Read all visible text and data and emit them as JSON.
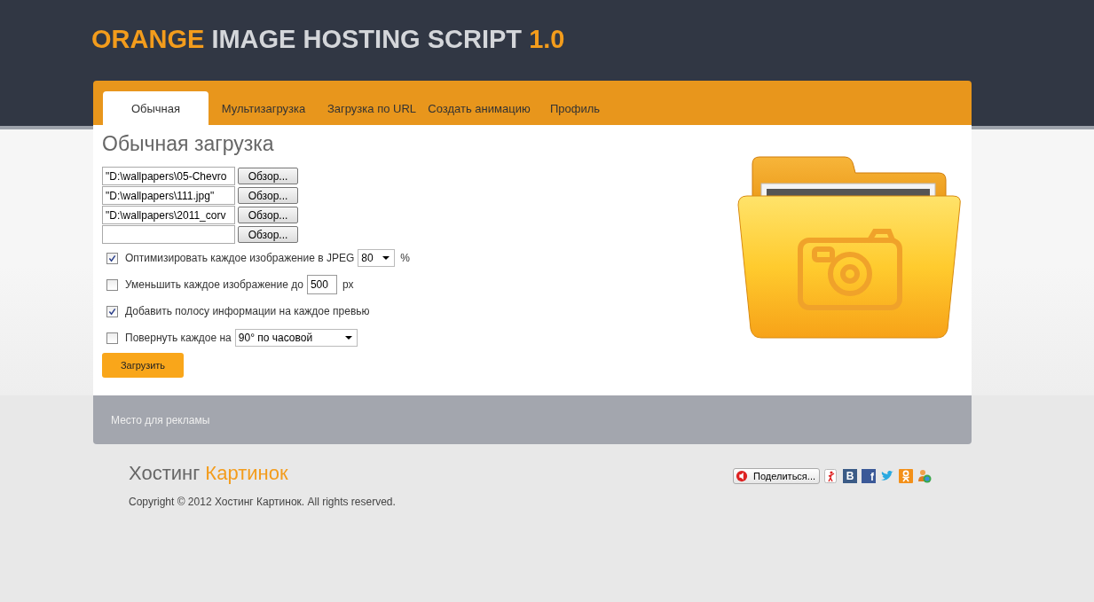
{
  "logo": {
    "parts": [
      {
        "text": "ORANGE",
        "accent": true
      },
      {
        "text": "IMAGE HOSTING SCRIPT",
        "accent": false
      },
      {
        "text": "1.0",
        "accent": true
      }
    ]
  },
  "tabs": [
    {
      "label": "Обычная",
      "selected": true
    },
    {
      "label": "Мультизагрузка",
      "selected": false
    },
    {
      "label": "Загрузка по URL",
      "selected": false
    },
    {
      "label": "Создать анимацию",
      "selected": false
    },
    {
      "label": "Профиль",
      "selected": false
    }
  ],
  "heading": "Обычная загрузка",
  "files": [
    {
      "value": "\"D:\\wallpapers\\05-Chevro",
      "button": "Обзор..."
    },
    {
      "value": "\"D:\\wallpapers\\111.jpg\"",
      "button": "Обзор..."
    },
    {
      "value": "\"D:\\wallpapers\\2011_corv",
      "button": "Обзор..."
    },
    {
      "button": "Обзор..."
    }
  ],
  "options": [
    {
      "kind": "select",
      "checked": true,
      "label": "Оптимизировать каждое изображение в JPEG",
      "value": "80",
      "suffix": "%"
    },
    {
      "kind": "number",
      "checked": false,
      "label": "Уменьшить каждое изображение до",
      "value": "500",
      "suffix": "px"
    },
    {
      "kind": "plain",
      "checked": true,
      "label": "Добавить полосу информации на каждое превью"
    },
    {
      "kind": "wide-select",
      "checked": false,
      "label": "Повернуть каждое на",
      "value": "90° по часовой"
    }
  ],
  "upload_button": "Загрузить",
  "ad_banner": "Место для рекламы",
  "footer": {
    "title": [
      {
        "text": "Хостинг",
        "accent": false
      },
      {
        "text": "Картинок",
        "accent": true
      }
    ],
    "copyright": "Copyright © 2012 Хостинг Картинок. All rights reserved.",
    "share": {
      "button": "Поделиться...",
      "icons": [
        {
          "kind": "figure"
        },
        {
          "kind": "vk",
          "glyph": "В"
        },
        {
          "kind": "facebook",
          "glyph": "f"
        },
        {
          "kind": "twitter"
        },
        {
          "kind": "odnoklassniki"
        },
        {
          "kind": "people"
        }
      ]
    }
  }
}
